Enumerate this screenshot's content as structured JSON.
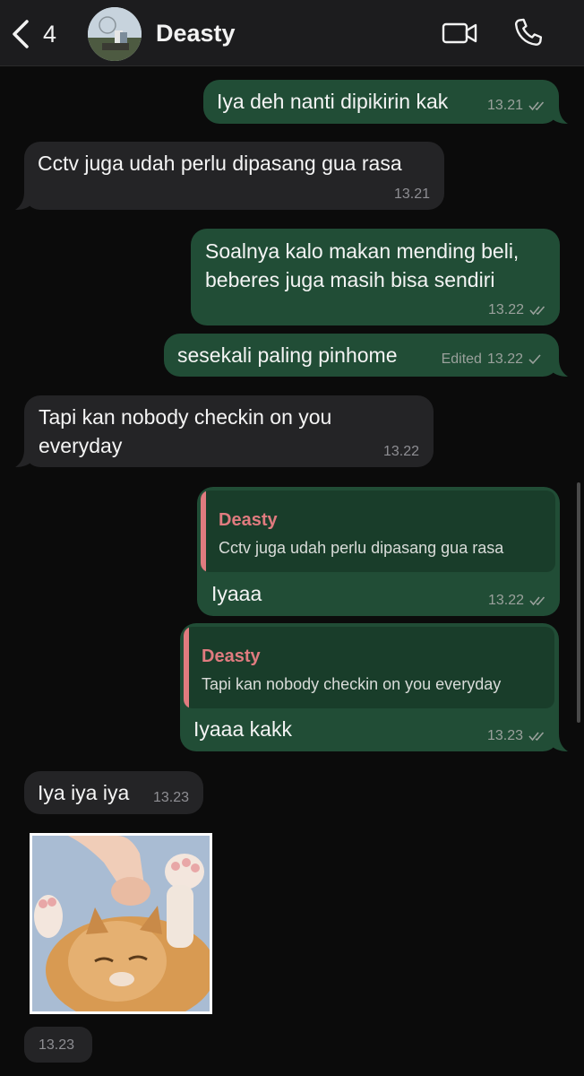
{
  "header": {
    "back_count": "4",
    "contact_name": "Deasty"
  },
  "messages": [
    {
      "text": "Iya deh nanti dipikirin kak",
      "time": "13.21"
    },
    {
      "text": "Cctv juga udah perlu dipasang gua rasa",
      "time": "13.21"
    },
    {
      "line1": "Soalnya kalo makan mending beli,",
      "line2": "beberes juga masih bisa sendiri",
      "time": "13.22"
    },
    {
      "text": "sesekali paling pinhome",
      "edited": "Edited",
      "time": "13.22"
    },
    {
      "line1": "Tapi kan nobody checkin on you",
      "line2": "everyday",
      "time": "13.22"
    },
    {
      "quote_name": "Deasty",
      "quote_text": "Cctv juga udah perlu dipasang gua rasa",
      "text": "Iyaaa",
      "time": "13.22"
    },
    {
      "quote_name": "Deasty",
      "quote_text": "Tapi kan nobody checkin on you everyday",
      "text": "Iyaaa kakk",
      "time": "13.23"
    },
    {
      "text": "Iya iya iya",
      "time": "13.23"
    },
    {
      "sticker": "cat-sticker",
      "time": "13.23"
    }
  ],
  "colors": {
    "outgoing_bubble": "#214d36",
    "incoming_bubble": "#242426",
    "quote_accent": "#e07b7f",
    "background": "#0b0b0b"
  },
  "icons": {
    "back": "chevron-left-icon",
    "video": "video-camera-icon",
    "call": "phone-icon",
    "read": "double-check-icon",
    "sent": "single-check-icon"
  }
}
